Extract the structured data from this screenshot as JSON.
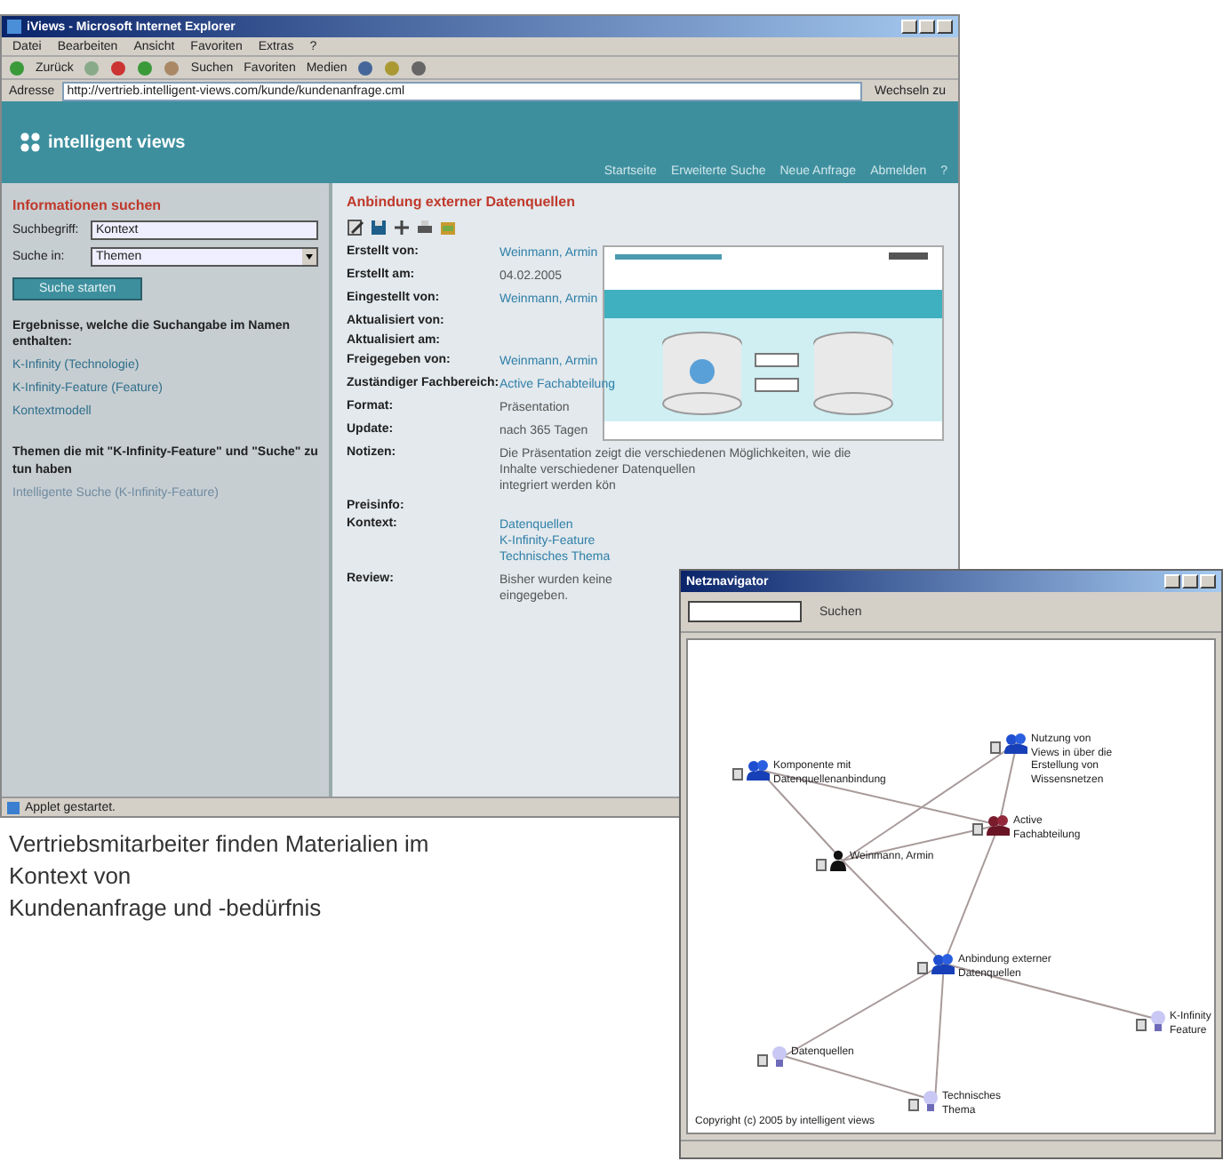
{
  "browser": {
    "title": "iViews - Microsoft Internet Explorer",
    "menu": [
      "Datei",
      "Bearbeiten",
      "Ansicht",
      "Favoriten",
      "Extras",
      "?"
    ],
    "toolbar": [
      "Zurück",
      "Suchen",
      "Favoriten",
      "Medien"
    ],
    "address_label": "Adresse",
    "address": "http://vertrieb.intelligent-views.com/kunde/kundenanfrage.cml",
    "go_label": "Wechseln zu"
  },
  "site": {
    "logo": "intelligent views",
    "nav": [
      "Startseite",
      "Erweiterte Suche",
      "Neue Anfrage",
      "Abmelden",
      "?"
    ]
  },
  "search_panel": {
    "heading": "Informationen suchen",
    "term_label": "Suchbegriff:",
    "term_value": "Kontext",
    "scope_label": "Suche in:",
    "scope_value": "Themen",
    "button": "Suche starten",
    "results_heading": "Ergebnisse, welche die Suchangabe im Namen enthalten:",
    "results": [
      {
        "text": "K-Infinity (Technologie)",
        "faded": false
      },
      {
        "text": "K-Infinity-Feature (Feature)",
        "faded": false
      },
      {
        "text": "Kontextmodell",
        "faded": false
      }
    ],
    "related_heading": "Themen die mit \"K-Infinity-Feature\" und \"Suche\" zu tun haben",
    "related": [
      {
        "text": "Intelligente Suche (K-Infinity-Feature)",
        "faded": true
      }
    ]
  },
  "detail": {
    "heading": "Anbindung externer Datenquellen",
    "fields": [
      {
        "label": "Erstellt von:",
        "values": [
          "Weinmann, Armin"
        ],
        "link": true
      },
      {
        "label": "Erstellt am:",
        "values": [
          "04.02.2005"
        ],
        "link": false
      },
      {
        "label": "Eingestellt von:",
        "values": [
          "Weinmann, Armin"
        ],
        "link": true
      },
      {
        "label": "Aktualisiert von:"
      },
      {
        "label": "Aktualisiert am:"
      },
      {
        "label": "Freigegeben von:",
        "values": [
          "Weinmann, Armin"
        ],
        "link": true
      },
      {
        "label": "Zuständiger Fachbereich:",
        "values": [
          "Active Fachabteilung"
        ],
        "link": true
      },
      {
        "label": "Format:",
        "values": [
          "Präsentation"
        ],
        "link": false
      },
      {
        "label": "Update:",
        "values": [
          "nach 365 Tagen"
        ],
        "link": false
      },
      {
        "label": "Notizen:",
        "values": [
          "Die Präsentation zeigt die verschiedenen Möglichkeiten, wie die",
          "Inhalte verschiedener Datenquellen",
          "integriert werden kön"
        ],
        "link": false
      },
      {
        "label": "Preisinfo:"
      },
      {
        "label": "Kontext:",
        "values": [
          "Datenquellen",
          "K-Infinity-Feature",
          "Technisches Thema"
        ],
        "link": true
      },
      {
        "label": "Review:",
        "values": [
          "Bisher wurden keine",
          "eingegeben."
        ],
        "link": false
      }
    ]
  },
  "status_bar": "Applet gestartet.",
  "graph_window": {
    "title": "Netznavigator",
    "search_button": "Suchen",
    "nodes": [
      {
        "kind": "topic",
        "lines": [
          "Komponente mit",
          "Datenquellenanbindung"
        ]
      },
      {
        "kind": "topic",
        "lines": [
          "Nutzung von",
          "Views in über die",
          "Erstellung von",
          "Wissensnetzen"
        ]
      },
      {
        "kind": "department",
        "lines": [
          "Active",
          "Fachabteilung"
        ]
      },
      {
        "kind": "person",
        "lines": [
          "Weinmann, Armin"
        ]
      },
      {
        "kind": "topic",
        "lines": [
          "Anbindung externer",
          "Datenquellen"
        ]
      },
      {
        "kind": "feature",
        "lines": [
          "Datenquellen"
        ]
      },
      {
        "kind": "feature",
        "lines": [
          "Technisches",
          "Thema"
        ]
      },
      {
        "kind": "feature",
        "lines": [
          "K-Infinity",
          "Feature"
        ]
      }
    ],
    "copyright": "Copyright (c) 2005 by intelligent views"
  },
  "caption": [
    "Vertriebsmitarbeiter finden Materialien im",
    "Kontext von",
    "Kundenanfrage und -bedürfnis"
  ]
}
